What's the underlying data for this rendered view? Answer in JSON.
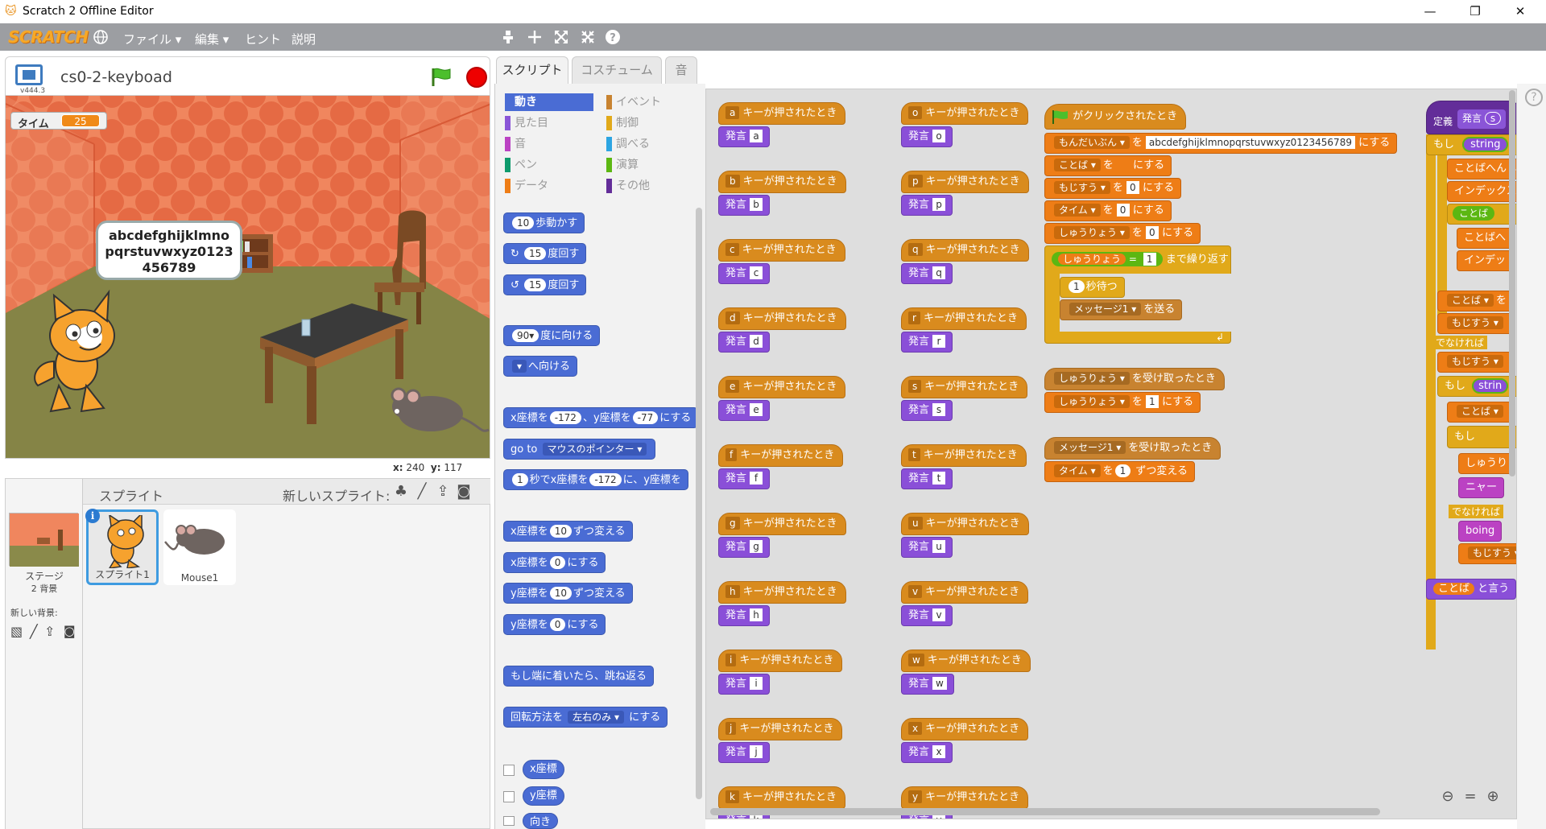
{
  "window": {
    "title": "Scratch 2 Offline Editor",
    "minimize": "—",
    "restore": "❐",
    "close": "✕"
  },
  "menubar": {
    "logo": "SCRATCH",
    "items": [
      "ファイル ▾",
      "編集 ▾",
      "ヒント",
      "説明"
    ]
  },
  "stage": {
    "version": "v444.3",
    "project_name": "cs0-2-keyboad",
    "timer_label": "タイム",
    "timer_value": "25",
    "speech": "abcdefghijklmnopqrstuvwxyz0123456789",
    "coord_x_label": "x:",
    "coord_x": "240",
    "coord_y_label": "y:",
    "coord_y": "117"
  },
  "sprites": {
    "header": "スプライト",
    "new_sprite": "新しいスプライト:",
    "stage_label": "ステージ",
    "stage_sub": "2 背景",
    "new_backdrop": "新しい背景:",
    "list": [
      {
        "name": "スプライト1"
      },
      {
        "name": "Mouse1"
      }
    ]
  },
  "tabs": [
    "スクリプト",
    "コスチューム",
    "音"
  ],
  "palette": {
    "categories": [
      {
        "label": "動き",
        "color": "#4a6cd4"
      },
      {
        "label": "イベント",
        "color": "#c88330"
      },
      {
        "label": "見た目",
        "color": "#8a55d7"
      },
      {
        "label": "制御",
        "color": "#e1a91a"
      },
      {
        "label": "音",
        "color": "#bb42c3"
      },
      {
        "label": "調べる",
        "color": "#2ca5e2"
      },
      {
        "label": "ペン",
        "color": "#0e9a6c"
      },
      {
        "label": "演算",
        "color": "#5cb712"
      },
      {
        "label": "データ",
        "color": "#ee7d16"
      },
      {
        "label": "その他",
        "color": "#632d99"
      }
    ],
    "blocks": {
      "move_n": "10",
      "move": "歩動かす",
      "turn_r_n": "15",
      "turn_r": "度回す",
      "turn_l_n": "15",
      "turn_l": "度回す",
      "point_dir_n": "90▾",
      "point_dir": "度に向ける",
      "point_towards": "へ向ける",
      "goto_xy_a": "x座標を",
      "goto_xy_x": "-172",
      "goto_xy_b": "、y座標を",
      "goto_xy_y": "-77",
      "goto_xy_c": "にする",
      "goto_a": "go to",
      "goto_target": "マウスのポインター ▾",
      "glide_n": "1",
      "glide_a": "秒でx座標を",
      "glide_x": "-172",
      "glide_b": "に、y座標を",
      "change_x_a": "x座標を",
      "change_x_n": "10",
      "change_x_b": "ずつ変える",
      "set_x_a": "x座標を",
      "set_x_n": "0",
      "set_x_b": "にする",
      "change_y_a": "y座標を",
      "change_y_n": "10",
      "change_y_b": "ずつ変える",
      "set_y_a": "y座標を",
      "set_y_n": "0",
      "set_y_b": "にする",
      "bounce": "もし端に着いたら、跳ね返る",
      "rot_a": "回転方法を",
      "rot_mode": "左右のみ ▾",
      "rot_b": "にする",
      "rep_x": "x座標",
      "rep_y": "y座標",
      "rep_dir": "向き"
    }
  },
  "scripts": {
    "hat_suffix": "キーが押されたとき",
    "say_label": "発言",
    "keys_col1": [
      "a",
      "b",
      "c",
      "d",
      "e",
      "f",
      "g",
      "h",
      "i",
      "j",
      "k"
    ],
    "keys_col2": [
      "o",
      "p",
      "q",
      "r",
      "s",
      "t",
      "u",
      "v",
      "w",
      "x",
      "y"
    ],
    "flag_hat": "がクリックされたとき",
    "main": {
      "var1": "もんだいぶん ▾",
      "to": "を",
      "var1_val": "abcdefghijklmnopqrstuvwxyz0123456789",
      "set": "にする",
      "var2": "ことば ▾",
      "var2_val": "",
      "var3": "もじすう ▾",
      "var3_val": "0",
      "var4": "タイム ▾",
      "var4_val": "0",
      "var5": "しゅうりょう ▾",
      "var5_val": "0",
      "until_var": "しゅうりょう",
      "until_eq": "=",
      "until_val": "1",
      "until_label": "まで繰り返す",
      "wait_n": "1",
      "wait": "秒待つ",
      "broadcast_msg": "メッセージ1 ▾",
      "broadcast": "を送る"
    },
    "recv1": {
      "msg": "しゅうりょう ▾",
      "label": "を受け取ったとき",
      "var": "しゅうりょう ▾",
      "to": "を",
      "val": "1",
      "set": "にする"
    },
    "recv2": {
      "msg": "メッセージ1 ▾",
      "label": "を受け取ったとき",
      "var": "タイム ▾",
      "to": "を",
      "val": "1",
      "change": "ずつ変える"
    },
    "define": {
      "def": "定義",
      "say": "発言",
      "arg": "s",
      "if": "もし",
      "string": "string",
      "kotobaheshi": "ことばへんし",
      "index": "インデックス",
      "kotoba": "ことば",
      "kotobahe": "ことばへ",
      "indexe": "インデッ",
      "kotoba2": "ことば ▾",
      "wo": "を",
      "mojisu": "もじすう ▾",
      "else": "でなければ",
      "mojisu2": "もじすう ▾",
      "if2": "もし",
      "strin": "strin",
      "kotoba3": "ことば ▾",
      "if3": "もし",
      "shuuri": "しゅうり",
      "nya": "ニャー",
      "else2": "でなければ",
      "boing": "boing",
      "mojisu3": "もじすう ▾",
      "kotoba_say": "ことば",
      "to_iu": "と言う"
    }
  }
}
